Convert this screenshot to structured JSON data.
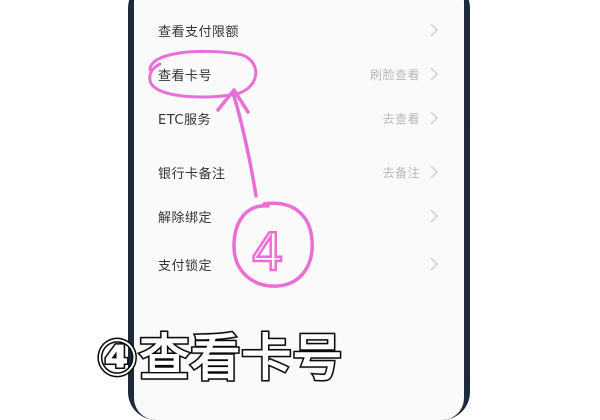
{
  "menu": {
    "items": [
      {
        "label": "查看支付限额",
        "value": "",
        "icon": "chevron-right-icon"
      },
      {
        "label": "查看卡号",
        "value": "刷脸查看",
        "icon": "chevron-right-icon"
      },
      {
        "label": "ETC服务",
        "value": "去查看",
        "icon": "chevron-right-icon"
      },
      {
        "label": "银行卡备注",
        "value": "去备注",
        "icon": "chevron-right-icon"
      },
      {
        "label": "解除绑定",
        "value": "",
        "icon": "chevron-right-icon"
      },
      {
        "label": "支付锁定",
        "value": "",
        "icon": "chevron-right-icon"
      }
    ]
  },
  "annotation": {
    "step_number": "4",
    "color": "#e86fd6"
  },
  "caption": {
    "text": "④查看卡号"
  },
  "colors": {
    "screen_bg": "#fafafa",
    "label": "#333333",
    "value": "#b8b8b8",
    "frame": "#2f4256"
  }
}
